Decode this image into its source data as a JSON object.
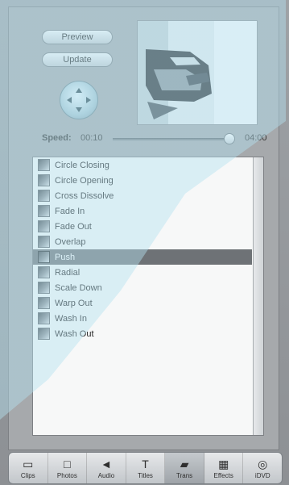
{
  "controls": {
    "preview_label": "Preview",
    "update_label": "Update",
    "speed_label": "Speed:",
    "speed_start": "00:10",
    "speed_end": "04:00",
    "speed_position": 0.95
  },
  "transitions": [
    {
      "label": "Circle Closing"
    },
    {
      "label": "Circle Opening"
    },
    {
      "label": "Cross Dissolve"
    },
    {
      "label": "Fade In"
    },
    {
      "label": "Fade Out"
    },
    {
      "label": "Overlap"
    },
    {
      "label": "Push",
      "selected": true
    },
    {
      "label": "Radial"
    },
    {
      "label": "Scale Down"
    },
    {
      "label": "Warp Out"
    },
    {
      "label": "Wash In"
    },
    {
      "label": "Wash Out"
    }
  ],
  "toolbar": {
    "clips_label": "Clips",
    "photos_label": "Photos",
    "audio_label": "Audio",
    "titles_label": "Titles",
    "trans_label": "Trans",
    "effects_label": "Effects",
    "idvd_label": "iDVD",
    "active": "trans"
  },
  "icons": {
    "clips": "clips-icon",
    "photos": "photos-icon",
    "audio": "audio-icon",
    "titles": "titles-icon",
    "trans": "transitions-icon",
    "effects": "effects-icon",
    "idvd": "idvd-icon"
  }
}
